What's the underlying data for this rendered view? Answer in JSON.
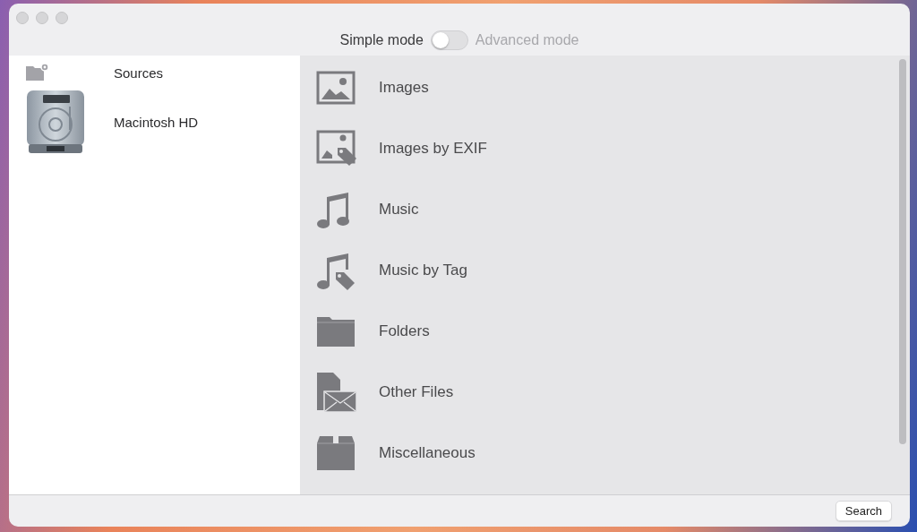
{
  "mode_switch": {
    "left_label": "Simple mode",
    "right_label": "Advanced mode",
    "on": false
  },
  "sources": [
    {
      "kind": "header",
      "label": "Sources"
    },
    {
      "kind": "drive",
      "label": "Macintosh HD"
    }
  ],
  "categories": [
    {
      "kind": "image",
      "label": "Images"
    },
    {
      "kind": "image-tag",
      "label": "Images by EXIF"
    },
    {
      "kind": "music",
      "label": "Music"
    },
    {
      "kind": "music-tag",
      "label": "Music by Tag"
    },
    {
      "kind": "folder",
      "label": "Folders"
    },
    {
      "kind": "files",
      "label": "Other Files"
    },
    {
      "kind": "box",
      "label": "Miscellaneous"
    }
  ],
  "search_button": "Search"
}
